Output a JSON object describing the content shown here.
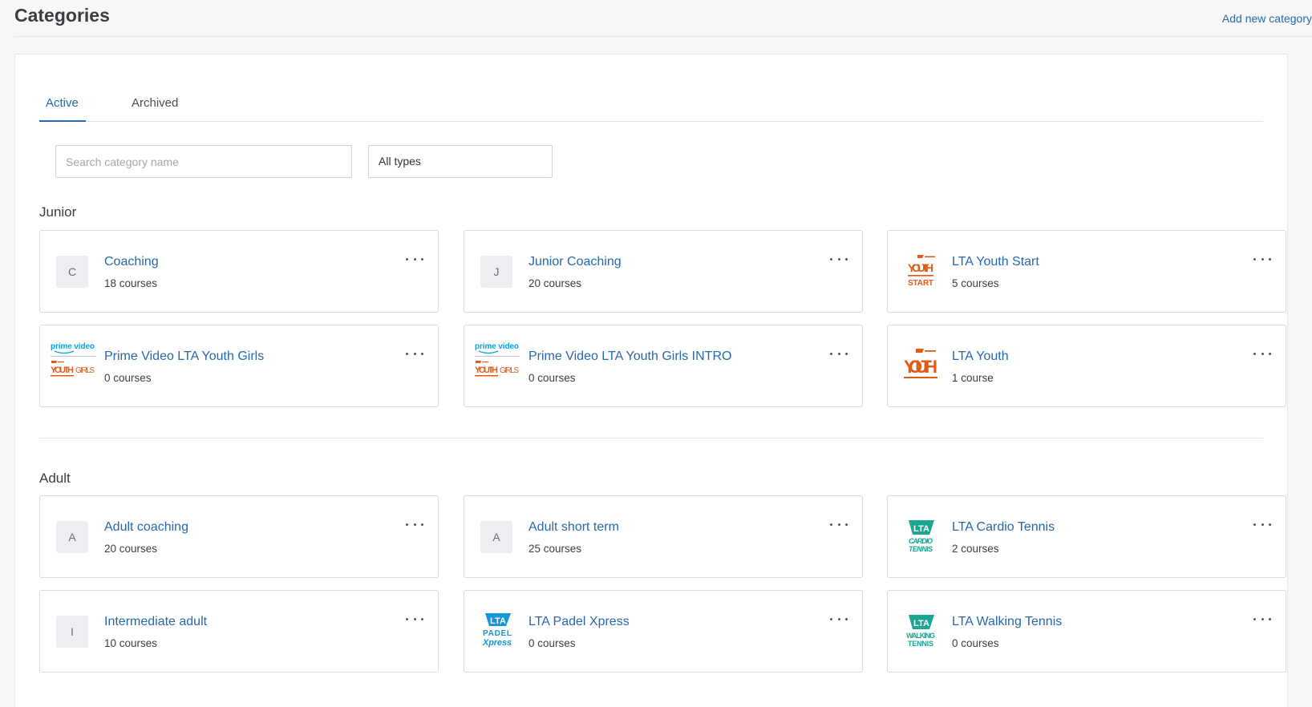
{
  "header": {
    "title": "Categories",
    "add_link": "Add new category"
  },
  "tabs": [
    {
      "label": "Active",
      "active": true
    },
    {
      "label": "Archived",
      "active": false
    }
  ],
  "filters": {
    "search_placeholder": "Search category name",
    "type_value": "All types"
  },
  "colors": {
    "accent": "#2768ad",
    "lta_orange": "#e15b16",
    "lta_teal": "#1aa692",
    "padel_blue": "#1596d8",
    "prime_blue": "#00a8e1"
  },
  "sections": [
    {
      "heading": "Junior",
      "cards": [
        {
          "title": "Coaching",
          "count": "18 courses",
          "icon": "letter-avatar",
          "letter": "C"
        },
        {
          "title": "Junior Coaching",
          "count": "20 courses",
          "icon": "letter-avatar",
          "letter": "J"
        },
        {
          "title": "LTA Youth Start",
          "count": "5 courses",
          "icon": "lta-youth-start-logo"
        },
        {
          "title": "Prime Video LTA Youth Girls",
          "count": "0 courses",
          "icon": "prime-video-youth-girls-logo"
        },
        {
          "title": "Prime Video LTA Youth Girls INTRO",
          "count": "0 courses",
          "icon": "prime-video-youth-girls-logo"
        },
        {
          "title": "LTA Youth",
          "count": "1 course",
          "icon": "lta-youth-logo"
        }
      ]
    },
    {
      "heading": "Adult",
      "cards": [
        {
          "title": "Adult coaching",
          "count": "20 courses",
          "icon": "letter-avatar",
          "letter": "A"
        },
        {
          "title": "Adult short term",
          "count": "25 courses",
          "icon": "letter-avatar",
          "letter": "A"
        },
        {
          "title": "LTA Cardio Tennis",
          "count": "2 courses",
          "icon": "lta-cardio-tennis-logo"
        },
        {
          "title": "Intermediate adult",
          "count": "10 courses",
          "icon": "letter-avatar",
          "letter": "I"
        },
        {
          "title": "LTA Padel Xpress",
          "count": "0 courses",
          "icon": "lta-padel-xpress-logo"
        },
        {
          "title": "LTA Walking Tennis",
          "count": "0 courses",
          "icon": "lta-walking-tennis-logo"
        }
      ]
    }
  ]
}
